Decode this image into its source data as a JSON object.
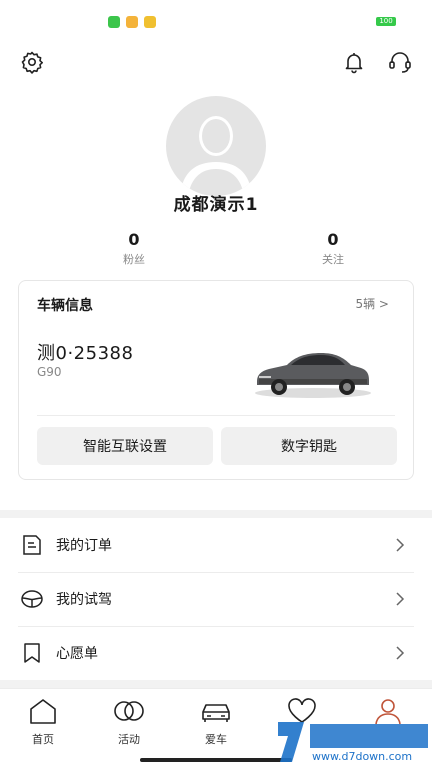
{
  "header": {
    "settings_icon": "gear-icon",
    "bell_icon": "bell-icon",
    "service_icon": "headset-icon"
  },
  "profile": {
    "name": "成都演示1",
    "fans_count": "0",
    "fans_label": "粉丝",
    "follow_count": "0",
    "follow_label": "关注"
  },
  "vehicle": {
    "title": "车辆信息",
    "count": "5辆 >",
    "plate": "测0·25388",
    "model": "G90",
    "button_smart": "智能互联设置",
    "button_key": "数字钥匙"
  },
  "menu": [
    {
      "label": "我的订单",
      "icon": "order-document-icon"
    },
    {
      "label": "我的试驾",
      "icon": "steering-wheel-icon"
    },
    {
      "label": "心愿单",
      "icon": "bookmark-icon"
    }
  ],
  "tabs": [
    {
      "label": "首页",
      "icon": "home-icon"
    },
    {
      "label": "活动",
      "icon": "rings-icon"
    },
    {
      "label": "爱车",
      "icon": "car-icon"
    },
    {
      "label": "",
      "icon": "heart-icon"
    },
    {
      "label": "",
      "icon": "user-icon"
    }
  ],
  "watermark": {
    "site": "www.d7down.com"
  },
  "colors": {
    "accent_orange": "#c0553a",
    "battery_green": "#35c94a"
  }
}
